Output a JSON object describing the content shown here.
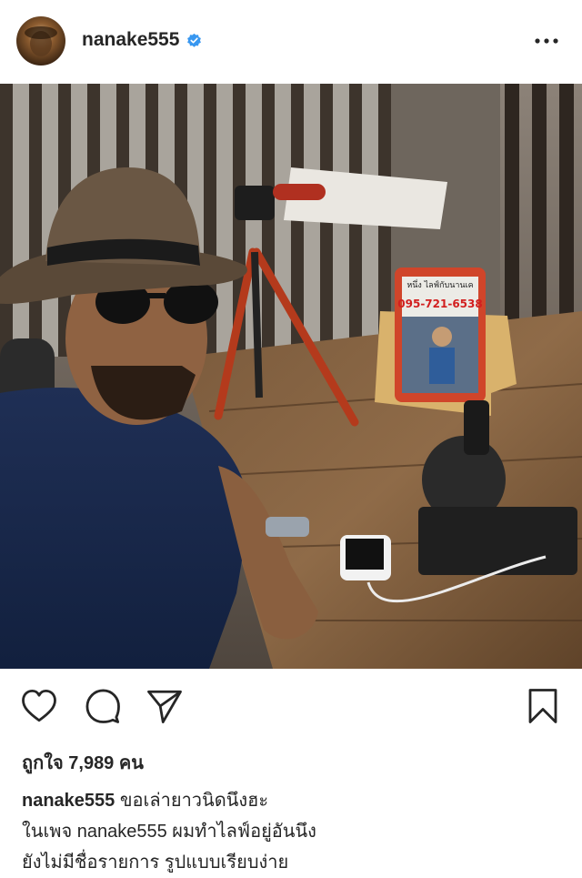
{
  "post": {
    "username": "nanake555",
    "verified": true,
    "avatar_icon": "profile-avatar",
    "more_icon": "more-options-icon"
  },
  "photo": {
    "tablet_overlay_line1": "หนึ่ง ไลฟ์กับนานเค",
    "tablet_overlay_line2": "095-721-6538"
  },
  "actions": {
    "like_icon": "heart-icon",
    "comment_icon": "comment-icon",
    "share_icon": "send-icon",
    "save_icon": "bookmark-icon"
  },
  "likes_text": "ถูกใจ 7,989 คน",
  "caption": {
    "username": "nanake555",
    "line1_text": " ขอเล่ายาวนิดนึงฮะ",
    "line2": "ในเพจ nanake555 ผมทำไลฟ์อยู่อันนึง",
    "line3": "ยังไม่มีชื่อรายการ รูปแบบเรียบง่าย"
  },
  "colors": {
    "text": "#262626",
    "verified_blue": "#3897f0",
    "background": "#ffffff"
  }
}
